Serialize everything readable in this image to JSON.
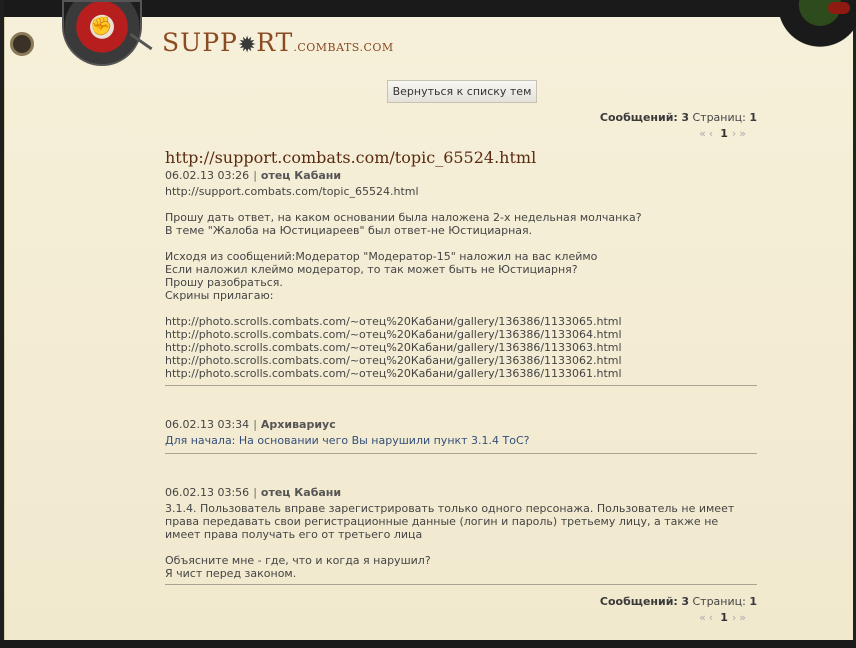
{
  "site": {
    "title_prefix": "SUPP",
    "title_suffix": "RT",
    "domain": ".COMBATS.COM"
  },
  "nav": {
    "back_label": "Вернуться к списку тем"
  },
  "stats": {
    "messages_label": "Сообщений:",
    "messages_count": "3",
    "pages_label": "Страниц:",
    "pages_count": "1"
  },
  "pager": {
    "first": "«",
    "prev": "‹",
    "current": "1",
    "next": "›",
    "last": "»"
  },
  "topic": {
    "title": "http://support.combats.com/topic_65524.html"
  },
  "posts": [
    {
      "date": "06.02.13 03:26",
      "author": "отец Кабани",
      "text": "http://support.combats.com/topic_65524.html\n\nПрошу дать ответ, на каком основании была наложена 2-х недельная молчанка?\nВ теме \"Жалоба на Юстициареев\" был ответ-не Юстициарная.\n\nИсходя из сообщений:Модератор \"Модератор-15\" наложил на вас клеймо\nЕсли наложил клеймо модератор, то так может быть не Юстициарня?\nПрошу разобраться.\nСкрины прилагаю:\n\nhttp://photo.scrolls.combats.com/~отец%20Кабани/gallery/136386/1133065.html\nhttp://photo.scrolls.combats.com/~отец%20Кабани/gallery/136386/1133064.html\nhttp://photo.scrolls.combats.com/~отец%20Кабани/gallery/136386/1133063.html\nhttp://photo.scrolls.combats.com/~отец%20Кабани/gallery/136386/1133062.html\nhttp://photo.scrolls.combats.com/~отец%20Кабани/gallery/136386/1133061.html"
    },
    {
      "date": "06.02.13 03:34",
      "author": "Архивариус",
      "text": "Для начала: На основании чего Вы нарушили пункт 3.1.4 ТоС?"
    },
    {
      "date": "06.02.13 03:56",
      "author": "отец Кабани",
      "text": "3.1.4. Пользователь вправе зарегистрировать только одного персонажа. Пользователь не имеет права передавать свои регистрационные данные (логин и пароль) третьему лицу, а также не имеет права получать его от третьего лица\n\nОбъясните мне - где, что и когда я нарушил?\nЯ чист перед законом."
    }
  ],
  "separator": "|",
  "colors": {
    "background": "#f3ecd4",
    "title": "#5a2a12",
    "link": "#334f7a",
    "brand": "#8a4a22"
  },
  "icons": {
    "logo": "fist-emblem-icon",
    "gear": "gear-icon"
  }
}
